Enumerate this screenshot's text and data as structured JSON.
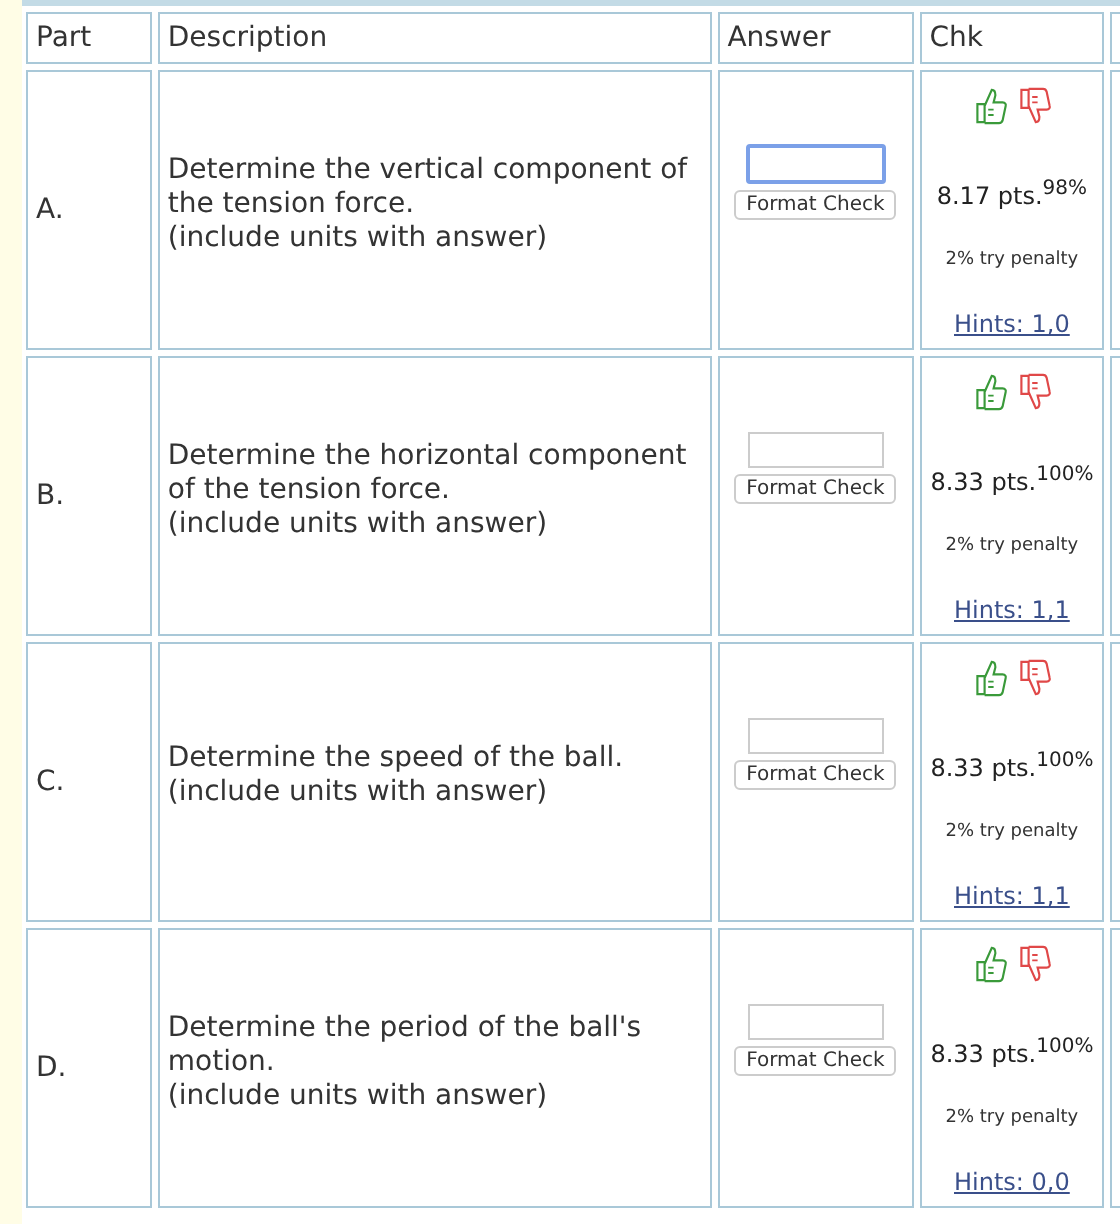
{
  "columns": [
    "Part",
    "Description",
    "Answer",
    "Chk"
  ],
  "parts": [
    {
      "label": "A.",
      "question": "Determine the vertical component of the tension force.",
      "note": "(include units with answer)",
      "answer": {
        "focused": true
      },
      "button": "Format Check",
      "points": "8.17 pts.$^{98%}$",
      "penalty": "2% try penalty",
      "hints": "Hints: 1,0"
    },
    {
      "label": "B.",
      "question": "Determine the horizontal component of the tension force.",
      "note": "(include units with answer)",
      "answer": {
        "focused": false
      },
      "button": "Format Check",
      "points": "8.33 pts.$^{100%}$",
      "penalty": "2% try penalty",
      "hints": "Hints: 1,1"
    },
    {
      "label": "C.",
      "question": "Determine the speed of the ball.",
      "note": "(include units with answer)",
      "answer": {
        "focused": false
      },
      "button": "Format Check",
      "points": "8.33 pts.$^{100%}$",
      "penalty": "2% try penalty",
      "hints": "Hints: 1,1"
    },
    {
      "label": "D.",
      "question": "Determine the period of the ball's motion.",
      "note": "(include units with answer)",
      "answer": {
        "focused": false
      },
      "button": "Format Check",
      "points": "8.33 pts.$^{100%}$",
      "penalty": "2% try penalty",
      "hints": "Hints: 0,0"
    }
  ]
}
